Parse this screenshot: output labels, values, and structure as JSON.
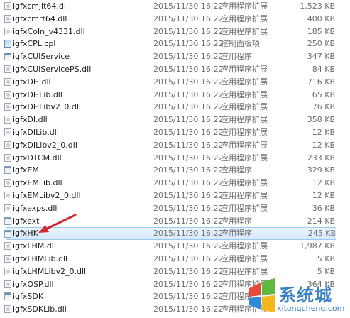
{
  "files": [
    {
      "name": "igfxcmjit64.dll",
      "date": "2015/11/30 16:22",
      "type": "应用程序扩展",
      "size": "1,523 KB",
      "kind": "dll",
      "selected": false
    },
    {
      "name": "igfxcmrt64.dll",
      "date": "2015/11/30 16:22",
      "type": "应用程序扩展",
      "size": "400 KB",
      "kind": "dll",
      "selected": false
    },
    {
      "name": "igfxCoIn_v4331.dll",
      "date": "2015/11/30 16:22",
      "type": "应用程序扩展",
      "size": "185 KB",
      "kind": "dll",
      "selected": false
    },
    {
      "name": "igfxCPL.cpl",
      "date": "2015/11/30 16:22",
      "type": "控制面板项",
      "size": "250 KB",
      "kind": "cpl",
      "selected": false
    },
    {
      "name": "igfxCUIService",
      "date": "2015/11/30 16:22",
      "type": "应用程序",
      "size": "347 KB",
      "kind": "exe",
      "selected": false
    },
    {
      "name": "igfxCUIServicePS.dll",
      "date": "2015/11/30 16:22",
      "type": "应用程序扩展",
      "size": "84 KB",
      "kind": "dll",
      "selected": false
    },
    {
      "name": "igfxDH.dll",
      "date": "2015/11/30 16:22",
      "type": "应用程序扩展",
      "size": "716 KB",
      "kind": "dll",
      "selected": false
    },
    {
      "name": "igfxDHLib.dll",
      "date": "2015/11/30 16:22",
      "type": "应用程序扩展",
      "size": "65 KB",
      "kind": "dll",
      "selected": false
    },
    {
      "name": "igfxDHLibv2_0.dll",
      "date": "2015/11/30 16:22",
      "type": "应用程序扩展",
      "size": "76 KB",
      "kind": "dll",
      "selected": false
    },
    {
      "name": "igfxDI.dll",
      "date": "2015/11/30 16:22",
      "type": "应用程序扩展",
      "size": "358 KB",
      "kind": "dll",
      "selected": false
    },
    {
      "name": "igfxDILib.dll",
      "date": "2015/11/30 16:22",
      "type": "应用程序扩展",
      "size": "12 KB",
      "kind": "dll",
      "selected": false
    },
    {
      "name": "igfxDILibv2_0.dll",
      "date": "2015/11/30 16:22",
      "type": "应用程序扩展",
      "size": "12 KB",
      "kind": "dll",
      "selected": false
    },
    {
      "name": "igfxDTCM.dll",
      "date": "2015/11/30 16:22",
      "type": "应用程序扩展",
      "size": "233 KB",
      "kind": "dll",
      "selected": false
    },
    {
      "name": "igfxEM",
      "date": "2015/11/30 16:22",
      "type": "应用程序",
      "size": "329 KB",
      "kind": "exe",
      "selected": false
    },
    {
      "name": "igfxEMLib.dll",
      "date": "2015/11/30 16:22",
      "type": "应用程序扩展",
      "size": "12 KB",
      "kind": "dll",
      "selected": false
    },
    {
      "name": "igfxEMLibv2_0.dll",
      "date": "2015/11/30 16:22",
      "type": "应用程序扩展",
      "size": "12 KB",
      "kind": "dll",
      "selected": false
    },
    {
      "name": "igfxexps.dll",
      "date": "2015/11/30 16:22",
      "type": "应用程序扩展",
      "size": "36 KB",
      "kind": "dll",
      "selected": false
    },
    {
      "name": "igfxext",
      "date": "2015/11/30 16:22",
      "type": "应用程序",
      "size": "214 KB",
      "kind": "exe",
      "selected": false
    },
    {
      "name": "igfxHK",
      "date": "2015/11/30 16:22",
      "type": "应用程序",
      "size": "245 KB",
      "kind": "exe",
      "selected": true
    },
    {
      "name": "igfxLHM.dll",
      "date": "2015/11/30 16:22",
      "type": "应用程序扩展",
      "size": "1,987 KB",
      "kind": "dll",
      "selected": false
    },
    {
      "name": "igfxLHMLib.dll",
      "date": "2015/11/30 16:22",
      "type": "应用程序扩展",
      "size": "5 KB",
      "kind": "dll",
      "selected": false
    },
    {
      "name": "igfxLHMLibv2_0.dll",
      "date": "2015/11/30 16:22",
      "type": "应用程序扩展",
      "size": "5 KB",
      "kind": "dll",
      "selected": false
    },
    {
      "name": "igfxOSP.dll",
      "date": "2015/11/30 16:22",
      "type": "应用程序扩展",
      "size": "364 KB",
      "kind": "dll",
      "selected": false
    },
    {
      "name": "igfxSDK",
      "date": "2015/11/30 16:22",
      "type": "应用程序",
      "size": "",
      "kind": "exe",
      "selected": false
    },
    {
      "name": "igfxSDKLib.dll",
      "date": "2015/11/30 16:22",
      "type": "应用程序扩展",
      "size": "",
      "kind": "dll",
      "selected": false
    }
  ],
  "watermark": {
    "text": "系统城",
    "url": "xitongcheng.com"
  },
  "colors": {
    "selection": "#d6eafb",
    "selection_border": "#9ccaee",
    "arrow": "#d4272e"
  }
}
